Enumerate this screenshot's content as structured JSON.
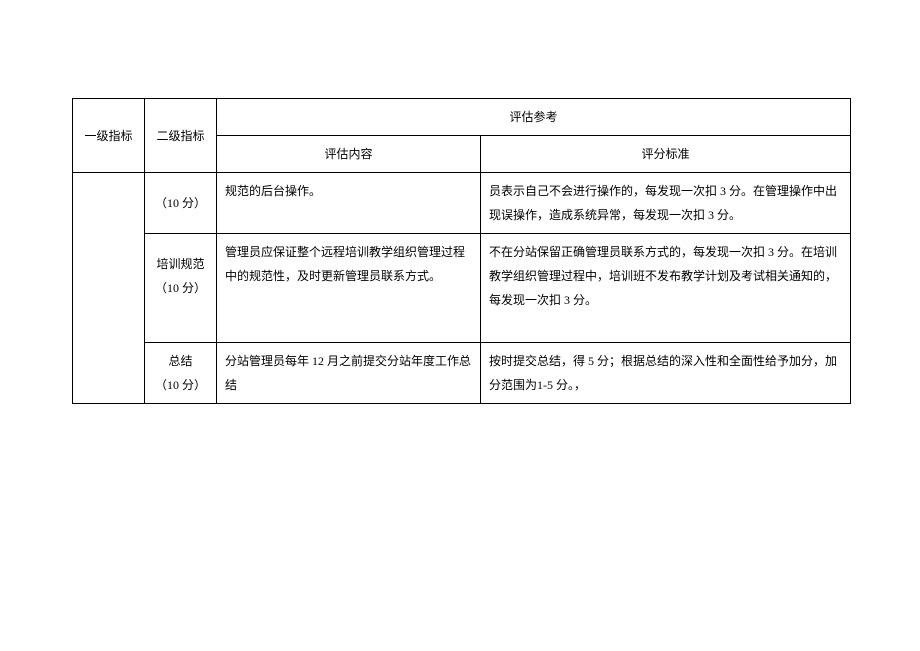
{
  "header": {
    "col1": "一级指标",
    "col2": "二级指标",
    "col3_group": "评估参考",
    "col3": "评估内容",
    "col4": "评分标准"
  },
  "rows": [
    {
      "col2": "（10 分）",
      "col3": "规范的后台操作。",
      "col4": "员表示自己不会进行操作的，每发现一次扣 3 分。在管理操作中出现误操作，造成系统异常，每发现一次扣 3 分。"
    },
    {
      "col2_line1": "培训规范",
      "col2_line2": "（10 分）",
      "col3": "管理员应保证整个远程培训教学组织管理过程中的规范性，及时更新管理员联系方式。",
      "col4": "不在分站保留正确管理员联系方式的，每发现一次扣 3 分。在培训教学组织管理过程中，培训班不发布教学计划及考试相关通知的，每发现一次扣 3 分。"
    },
    {
      "col2_line1": "总结",
      "col2_line2": "（10 分）",
      "col3": "分站管理员每年 12 月之前提交分站年度工作总结",
      "col4": "按时提交总结，得 5 分；根据总结的深入性和全面性给予加分，加分范围为1-5 分。，"
    }
  ]
}
